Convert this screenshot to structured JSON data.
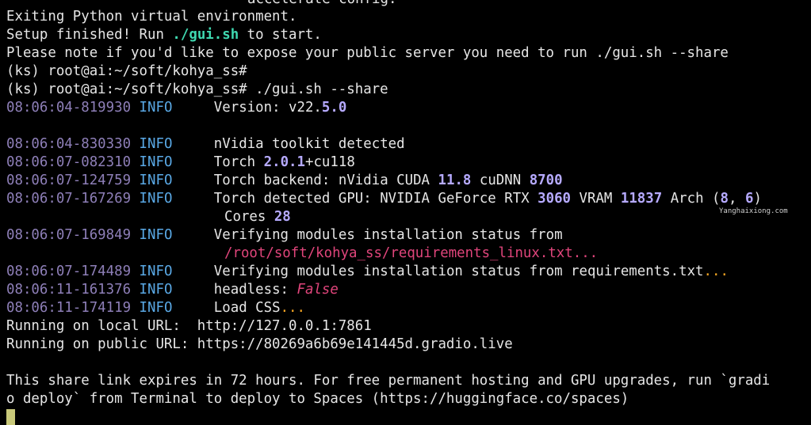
{
  "colors": {
    "background": "#000000",
    "text": "#e6e6e6",
    "timestamp": "#8e7fb8",
    "level_info": "#5aa9e6",
    "number_highlight": "#b6aaff",
    "script_highlight": "#3fd8b0",
    "path_highlight": "#e0457b",
    "ellipsis_highlight": "#f6a623",
    "cursor": "#c9c97a"
  },
  "terminal": {
    "cut_top_line": "accelerate config.",
    "exiting": "Exiting Python virtual environment.",
    "setup_a": "Setup finished! Run ",
    "setup_cmd": "./gui.sh",
    "setup_b": " to start.",
    "note": "Please note if you'd like to expose your public server you need to run ./gui.sh --share",
    "prompt1": "(ks) root@ai:~/soft/kohya_ss#",
    "prompt2": "(ks) root@ai:~/soft/kohya_ss# ./gui.sh --share",
    "logs": {
      "l1": {
        "ts": "08:06:04-819930",
        "level": "INFO",
        "a": "Version: v22.",
        "b": "5.0"
      },
      "l2": {
        "ts": "08:06:04-830330",
        "level": "INFO",
        "a": "nVidia toolkit detected"
      },
      "l3": {
        "ts": "08:06:07-082310",
        "level": "INFO",
        "a": "Torch ",
        "b": "2.0.1",
        "c": "+cu118"
      },
      "l4": {
        "ts": "08:06:07-124759",
        "level": "INFO",
        "a": "Torch backend: nVidia CUDA ",
        "b": "11.8",
        "c": " cuDNN ",
        "d": "8700"
      },
      "l5": {
        "ts": "08:06:07-167269",
        "level": "INFO",
        "a": "Torch detected GPU: NVIDIA GeForce RTX ",
        "b": "3060",
        "c": " VRAM ",
        "d": "11837",
        "e": " Arch (",
        "f": "8",
        "g": ", ",
        "h": "6",
        "i": ")"
      },
      "l5_cont_a": "Cores ",
      "l5_cont_b": "28",
      "l6": {
        "ts": "08:06:07-169849",
        "level": "INFO",
        "a": "Verifying modules installation status from"
      },
      "l6_cont": "/root/soft/kohya_ss/requirements_linux.txt...",
      "l7": {
        "ts": "08:06:07-174489",
        "level": "INFO",
        "a": "Verifying modules installation status from requirements.txt",
        "dots": "..."
      },
      "l8": {
        "ts": "08:06:11-161376",
        "level": "INFO",
        "a": "headless: ",
        "b": "False"
      },
      "l9": {
        "ts": "08:06:11-174119",
        "level": "INFO",
        "a": "Load CSS",
        "dots": "..."
      }
    },
    "local_url": "Running on local URL:  http://127.0.0.1:7861",
    "public_url": "Running on public URL: https://80269a6b69e141445d.gradio.live",
    "share1": "This share link expires in 72 hours. For free permanent hosting and GPU upgrades, run `gradi",
    "share2": "o deploy` from Terminal to deploy to Spaces (https://huggingface.co/spaces)"
  },
  "watermark": "Yanghaixiong.com"
}
